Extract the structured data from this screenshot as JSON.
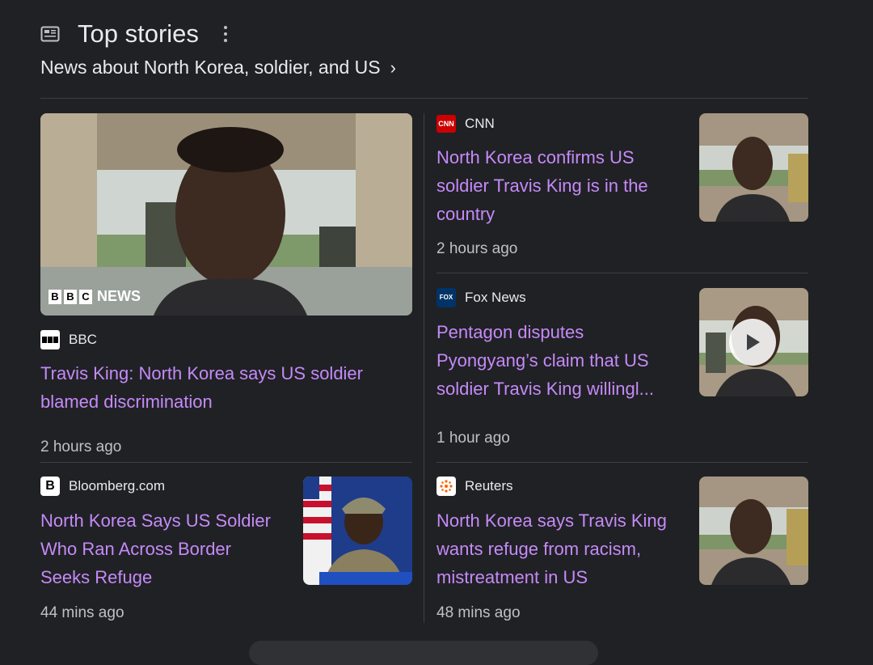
{
  "header": {
    "title": "Top stories",
    "subtitle": "News about North Korea, soldier, and US"
  },
  "stories": {
    "featured": {
      "source": "BBC",
      "headline": "Travis King: North Korea says US soldier blamed discrimination",
      "time": "2 hours ago",
      "watermark": "NEWS"
    },
    "cnn": {
      "source": "CNN",
      "headline": "North Korea confirms US soldier Travis King is in the country",
      "time": "2 hours ago"
    },
    "fox": {
      "source": "Fox News",
      "headline": "Pentagon disputes Pyongyang’s claim that US soldier Travis King willingl...",
      "time": "1 hour ago"
    },
    "bloomberg": {
      "source": "Bloomberg.com",
      "headline": "North Korea Says US Soldier Who Ran Across Border Seeks Refuge",
      "time": "44 mins ago"
    },
    "reuters": {
      "source": "Reuters",
      "headline": "North Korea says Travis King wants refuge from racism, mistreatment in US",
      "time": "48 mins ago"
    }
  },
  "colors": {
    "background": "#202124",
    "headline": "#c58af9",
    "divider": "#3c4043"
  }
}
